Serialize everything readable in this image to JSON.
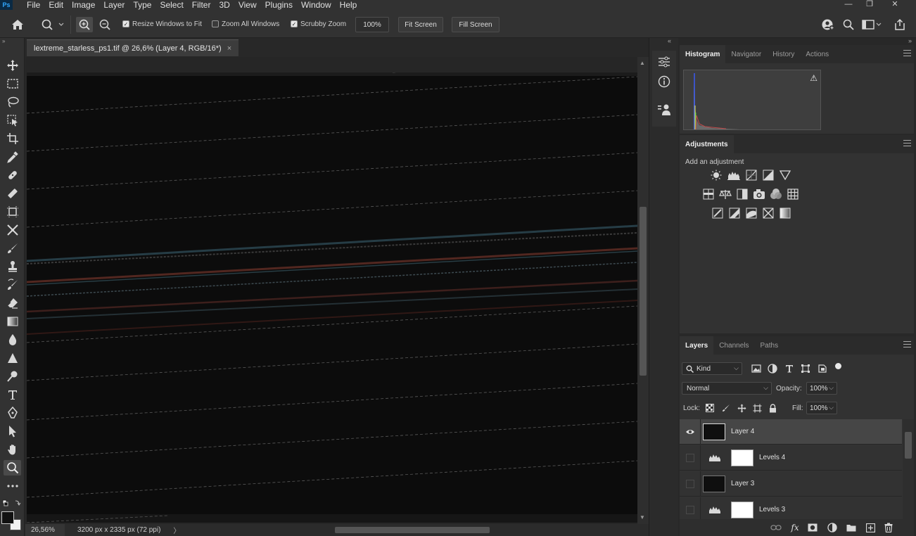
{
  "app": {
    "logo": "Ps",
    "menus": [
      "File",
      "Edit",
      "Image",
      "Layer",
      "Type",
      "Select",
      "Filter",
      "3D",
      "View",
      "Plugins",
      "Window",
      "Help"
    ]
  },
  "options": {
    "resize_windows_label": "Resize Windows to Fit",
    "zoom_all_windows_label": "Zoom All Windows",
    "scrubby_zoom_label": "Scrubby Zoom",
    "zoom_percent": "100%",
    "fit_screen_label": "Fit Screen",
    "fill_screen_label": "Fill Screen"
  },
  "document": {
    "tab_title": "lextreme_starless_ps1.tif @ 26,6% (Layer 4, RGB/16*)",
    "tab_close": "×",
    "zoom": "26,56%",
    "info": "3200 px x 2335 px (72 ppi)",
    "info_arrow": "〉"
  },
  "histogram_panel": {
    "tabs": [
      "Histogram",
      "Navigator",
      "History",
      "Actions"
    ],
    "warning": "⚠"
  },
  "adjustments_panel": {
    "tab": "Adjustments",
    "subtitle": "Add an adjustment"
  },
  "layers_panel": {
    "tabs": [
      "Layers",
      "Channels",
      "Paths"
    ],
    "filter_kind": "Kind",
    "blend_mode": "Normal",
    "opacity_label": "Opacity:",
    "opacity_value": "100%",
    "lock_label": "Lock:",
    "fill_label": "Fill:",
    "fill_value": "100%",
    "layers": [
      {
        "name": "Layer 4",
        "kind": "pixel",
        "visible": true,
        "selected": true
      },
      {
        "name": "Levels 4",
        "kind": "levels",
        "visible": false,
        "selected": false
      },
      {
        "name": "Layer 3",
        "kind": "pixel",
        "visible": false,
        "selected": false
      },
      {
        "name": "Levels 3",
        "kind": "levels",
        "visible": false,
        "selected": false
      }
    ]
  }
}
